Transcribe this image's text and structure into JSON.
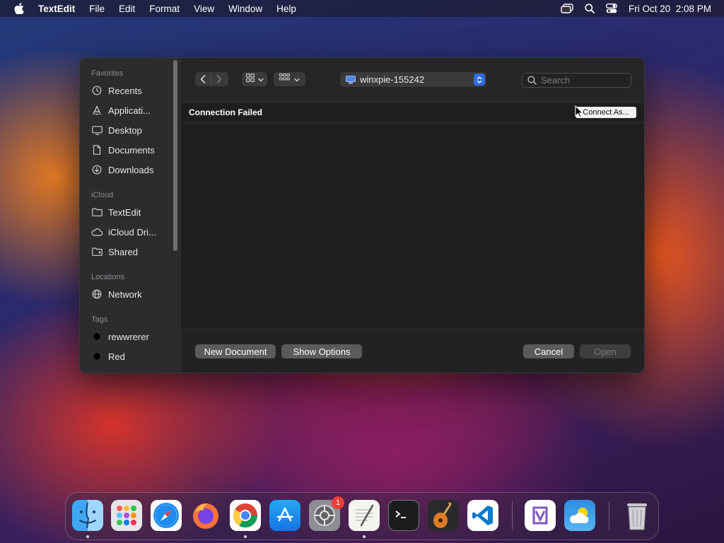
{
  "menubar": {
    "app_name": "TextEdit",
    "items": [
      "File",
      "Edit",
      "Format",
      "View",
      "Window",
      "Help"
    ],
    "datetime": "Fri Oct 20  2:08 PM"
  },
  "sidebar": {
    "sections": {
      "favorites": "Favorites",
      "icloud": "iCloud",
      "locations": "Locations",
      "tags": "Tags"
    },
    "favorites": [
      {
        "label": "Recents",
        "icon": "clock-icon"
      },
      {
        "label": "Applicati...",
        "icon": "applications-icon"
      },
      {
        "label": "Desktop",
        "icon": "desktop-icon"
      },
      {
        "label": "Documents",
        "icon": "document-icon"
      },
      {
        "label": "Downloads",
        "icon": "download-icon"
      }
    ],
    "icloud": [
      {
        "label": "TextEdit",
        "icon": "folder-icon"
      },
      {
        "label": "iCloud Dri...",
        "icon": "cloud-icon"
      },
      {
        "label": "Shared",
        "icon": "shared-folder-icon"
      }
    ],
    "locations": [
      {
        "label": "Network",
        "icon": "globe-icon"
      }
    ],
    "tags": [
      {
        "label": "rewwrerer",
        "color": "#000000"
      },
      {
        "label": "Red",
        "color": "#000000"
      }
    ]
  },
  "toolbar": {
    "location": "winxpie-155242",
    "search_placeholder": "Search"
  },
  "content": {
    "status_title": "Connection Failed",
    "connect_button": "Connect As..."
  },
  "footer": {
    "new_document": "New Document",
    "show_options": "Show Options",
    "cancel": "Cancel",
    "open": "Open"
  },
  "dock": {
    "apps": [
      "Finder",
      "Launchpad",
      "Safari",
      "Firefox",
      "Chrome",
      "App Store",
      "System Settings",
      "TextEdit",
      "Terminal",
      "GarageBand",
      "VS Code",
      "Visual Studio",
      "Weather",
      "Trash"
    ],
    "system_settings_badge": "1"
  },
  "colors": {
    "accent": "#2f6fe0",
    "badge": "#ef3b36"
  }
}
